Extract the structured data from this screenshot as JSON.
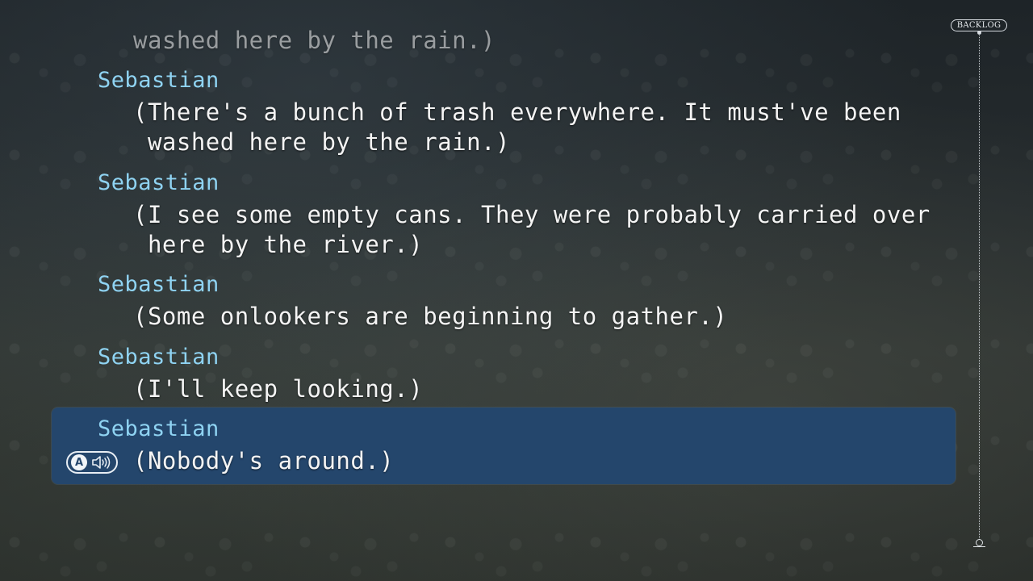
{
  "backlog": {
    "label": "BACKLOG",
    "entries": [
      {
        "speaker": "",
        "lines": [
          "washed here by the rain.)"
        ]
      },
      {
        "speaker": "Sebastian",
        "lines": [
          "(There's a bunch of trash everywhere. It must've been",
          " washed here by the rain.)"
        ]
      },
      {
        "speaker": "Sebastian",
        "lines": [
          "(I see some empty cans. They were probably carried over",
          " here by the river.)"
        ]
      },
      {
        "speaker": "Sebastian",
        "lines": [
          "(Some onlookers are beginning to gather.)"
        ]
      },
      {
        "speaker": "Sebastian",
        "lines": [
          "(I'll keep looking.)"
        ]
      },
      {
        "speaker": "Sebastian",
        "lines": [
          "(Nobody's around.)"
        ]
      }
    ]
  },
  "voice_button": {
    "button_glyph": "A",
    "icon": "speaker-icon"
  },
  "colors": {
    "speaker_name": "#8fd3f2",
    "highlight": "#24466c",
    "text": "#f4f4f4"
  }
}
